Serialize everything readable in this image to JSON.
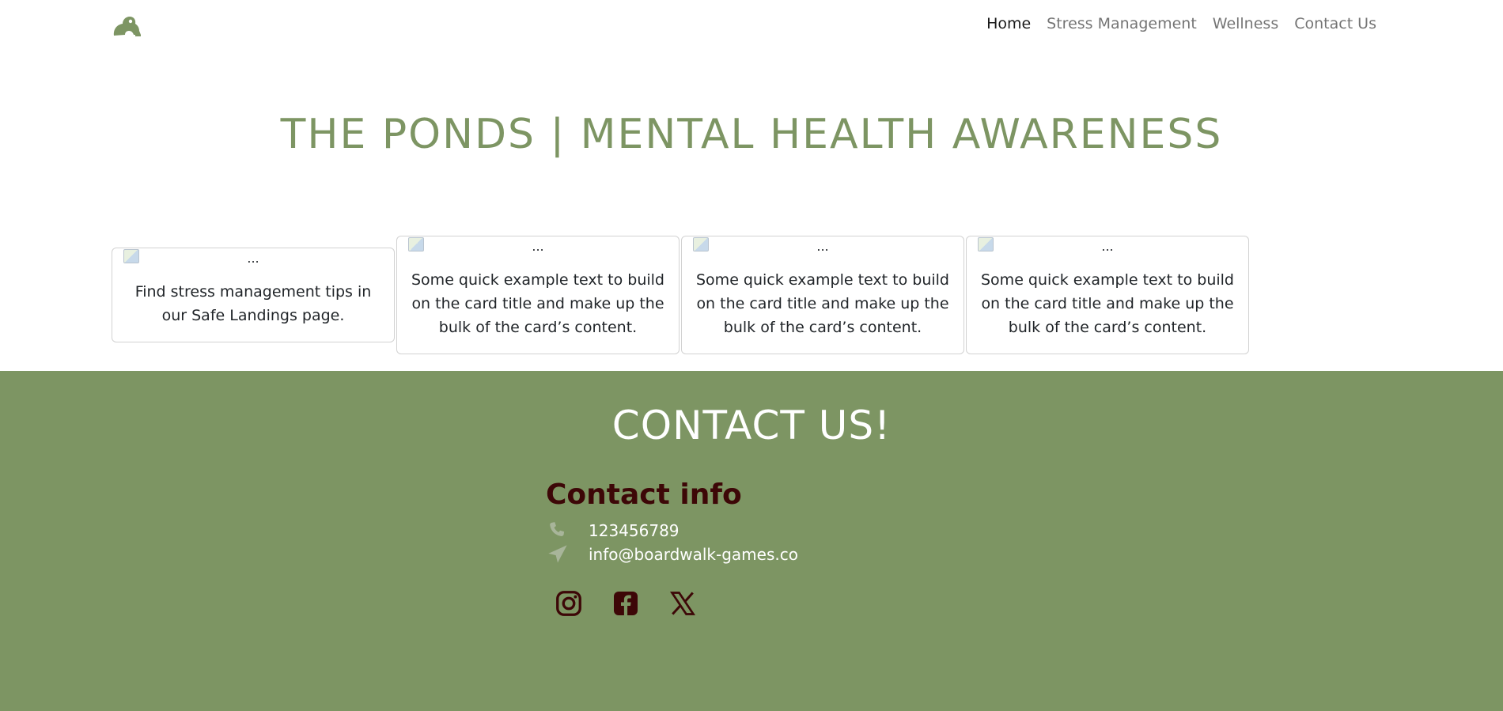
{
  "nav": {
    "logo_icon": "frog-icon",
    "links": [
      {
        "label": "Home",
        "active": true
      },
      {
        "label": "Stress Management",
        "active": false
      },
      {
        "label": "Wellness",
        "active": false
      },
      {
        "label": "Contact Us",
        "active": false
      }
    ]
  },
  "main": {
    "title": "THE PONDS | MENTAL HEALTH AWARENESS",
    "cards": [
      {
        "img_alt": "...",
        "text": "Find stress management tips in our Safe Landings page."
      },
      {
        "img_alt": "...",
        "text": "Some quick example text to build on the card title and make up the bulk of the card’s content."
      },
      {
        "img_alt": "...",
        "text": "Some quick example text to build on the card title and make up the bulk of the card’s content."
      },
      {
        "img_alt": "...",
        "text": "Some quick example text to build on the card title and make up the bulk of the card’s content."
      }
    ]
  },
  "footer": {
    "title": "CONTACT US!",
    "heading": "Contact info",
    "phone": "123456789",
    "email": "info@boardwalk-games.co",
    "social": [
      "instagram-icon",
      "facebook-icon",
      "x-twitter-icon"
    ]
  },
  "colors": {
    "brand_green": "#7d9563",
    "dark_maroon": "#3d0707",
    "white": "#ffffff"
  }
}
